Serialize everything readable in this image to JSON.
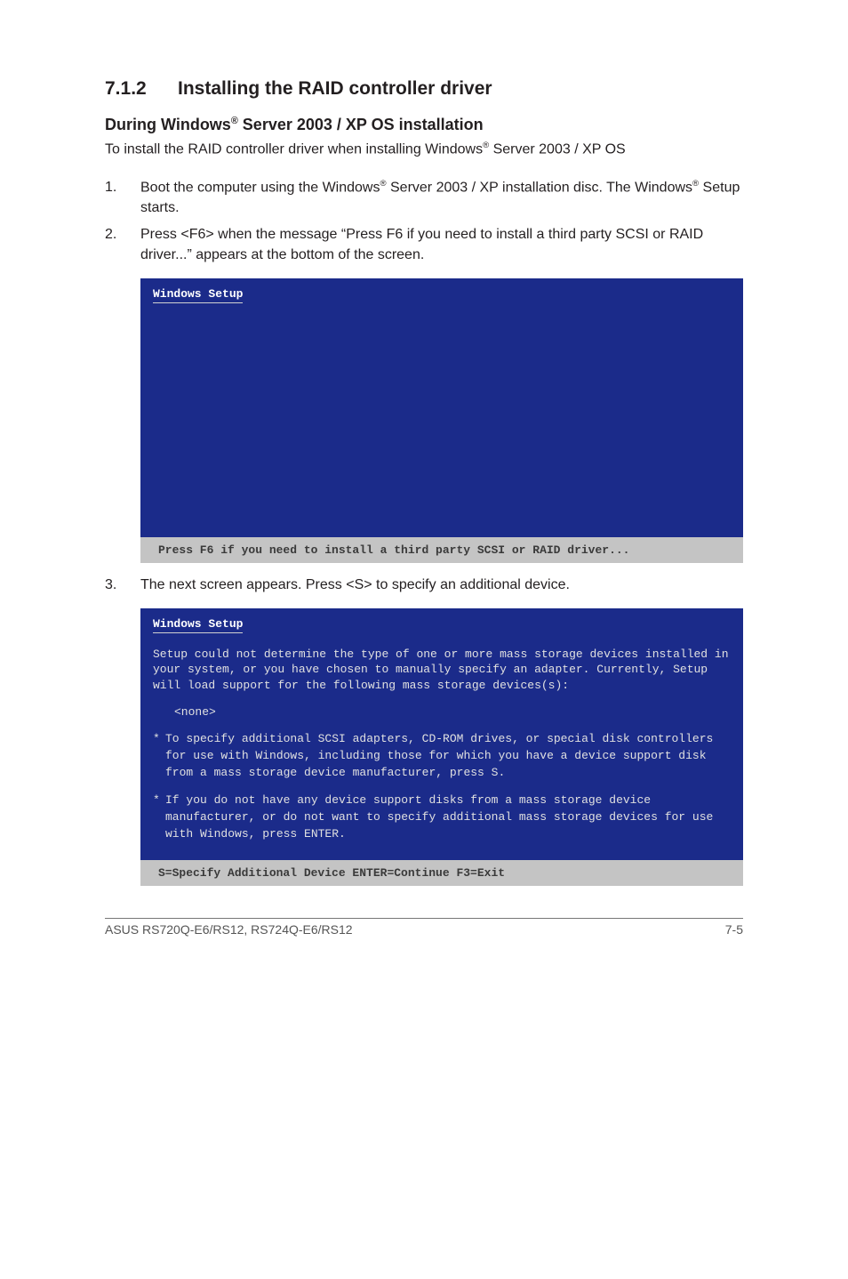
{
  "section": {
    "number": "7.1.2",
    "title": "Installing the RAID controller driver"
  },
  "subheading": {
    "prefix": "During Windows",
    "reg": "®",
    "suffix": " Server 2003 / XP OS installation"
  },
  "intro": {
    "before": "To install the RAID controller driver when installing Windows",
    "reg": "®",
    "after": " Server 2003 / XP OS"
  },
  "steps": {
    "s1": {
      "num": "1.",
      "t1": "Boot the computer using the Windows",
      "reg1": "®",
      "t2": " Server 2003 / XP installation disc. The Windows",
      "reg2": "®",
      "t3": " Setup starts."
    },
    "s2": {
      "num": "2.",
      "text": "Press <F6> when the message “Press F6 if you need to install a third party SCSI or RAID driver...” appears at the bottom of the screen."
    },
    "s3": {
      "num": "3.",
      "text": "The next screen appears. Press <S> to specify an additional device."
    }
  },
  "win1": {
    "title": "Windows Setup",
    "statusbar": "Press F6 if you need to install a third party SCSI or RAID driver..."
  },
  "win2": {
    "title": "Windows Setup",
    "para": "Setup could not determine the type of one or more mass storage devices installed in your system, or you have chosen to manually specify an adapter. Currently, Setup will load support for the following mass storage devices(s):",
    "none": "<none>",
    "b1": "To specify additional SCSI adapters, CD-ROM drives, or special disk controllers for use with Windows, including those for which you have a device support disk from a mass storage device manufacturer, press S.",
    "b2": "If you do not have any device support disks from a mass storage device manufacturer, or do not want to specify additional mass storage devices for use with Windows, press ENTER.",
    "statusbar": "S=Specify Additional Device   ENTER=Continue   F3=Exit"
  },
  "footer": {
    "left": "ASUS RS720Q-E6/RS12, RS724Q-E6/RS12",
    "right": "7-5"
  }
}
